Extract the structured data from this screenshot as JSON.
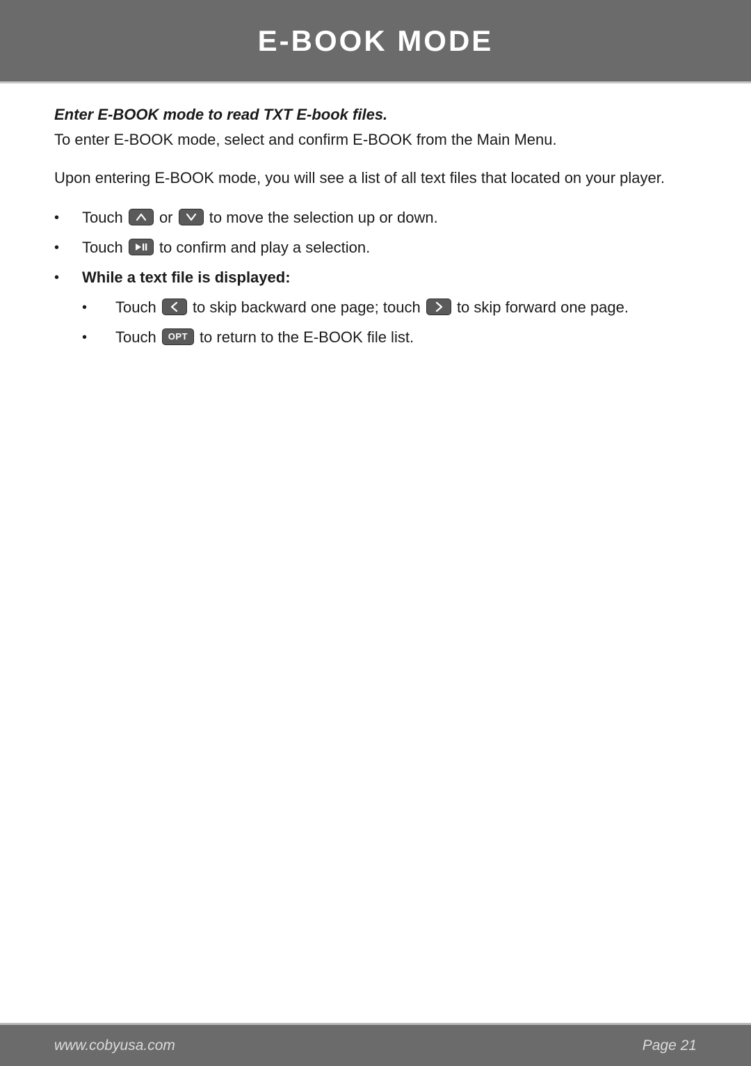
{
  "header": {
    "title": "E-BOOK MODE"
  },
  "intro": {
    "heading": "Enter E-BOOK mode to read TXT E-book files.",
    "p1": "To enter E-BOOK mode, select and confirm E-BOOK from the Main Menu.",
    "p2": "Upon entering E-BOOK mode, you will see a list of all text files that located on your player."
  },
  "bullets": {
    "b1_pre": "Touch ",
    "b1_mid": " or ",
    "b1_post": " to move the selection up or down.",
    "b2_pre": "Touch ",
    "b2_post": " to confirm and play a selection.",
    "b3_heading": "While a text file is displayed:",
    "b3a_pre": "Touch ",
    "b3a_mid": " to skip backward one page; touch ",
    "b3a_post": " to skip forward one page.",
    "b3b_pre": "Touch ",
    "b3b_post": " to return to the E-BOOK file list.",
    "opt_label": "OPT"
  },
  "footer": {
    "url": "www.cobyusa.com",
    "page": "Page 21"
  }
}
